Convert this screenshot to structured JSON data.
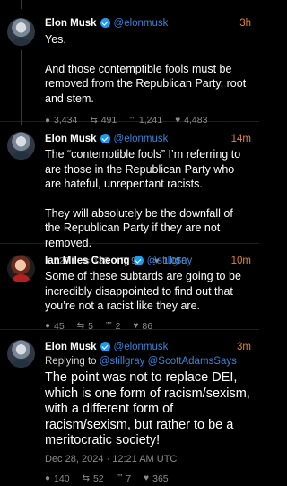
{
  "tweets": [
    {
      "name": "Elon Musk",
      "handle": "@elonmusk",
      "time": "3h",
      "paragraphs": [
        "Yes.",
        "And those contemptible fools must be removed from the Republican Party, root and stem."
      ],
      "metrics": {
        "replies": "3,434",
        "retweets": "491",
        "quotes": "1,241",
        "likes": "4,483"
      }
    },
    {
      "name": "Elon Musk",
      "handle": "@elonmusk",
      "time": "14m",
      "paragraphs": [
        "The “contemptible fools” I’m referring to are those in the Republican Party who are hateful, unrepentant racists.",
        "They will absolutely be the downfall of the Republican Party if they are not removed."
      ],
      "metrics": {
        "replies": "529",
        "retweets": "138",
        "quotes": "95",
        "likes": "1,050"
      }
    },
    {
      "name": "Ian Miles Cheong",
      "handle": "@stillgray",
      "time": "10m",
      "paragraphs": [
        "Some of these subtards are going to be incredibly disappointed to find out that you’re not a racist like they are."
      ],
      "metrics": {
        "replies": "45",
        "retweets": "5",
        "quotes": "2",
        "likes": "86"
      }
    },
    {
      "name": "Elon Musk",
      "handle": "@elonmusk",
      "time": "3m",
      "replying_label": "Replying to",
      "replying_mentions": "@stillgray @ScottAdamsSays",
      "text": "The point was not to replace DEI, which is one form of racism/sexism, with a different form of racism/sexism, but rather to be a meritocratic society!",
      "date": "Dec 28, 2024 · 12:21 AM UTC",
      "metrics": {
        "replies": "140",
        "retweets": "52",
        "quotes": "7",
        "likes": "365"
      }
    }
  ],
  "icons": {
    "reply": "comment-icon",
    "retweet": "retweet-icon",
    "quote": "quote-icon",
    "like": "heart-icon"
  },
  "colors": {
    "background": "#000000",
    "handle": "#3b82d6",
    "time": "#e0852d",
    "muted": "#8c8c8c",
    "verified": "#1d9bf0"
  }
}
